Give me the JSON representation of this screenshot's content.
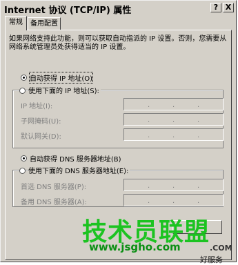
{
  "window": {
    "title": "Internet 协议 (TCP/IP) 属性",
    "help_btn": "?",
    "close_btn": "X"
  },
  "tabs": [
    "常规",
    "备用配置"
  ],
  "description": "如果网络支持此功能，则可以获取自动指派的 IP 设置。否则，您需要从网络系统管理员处获得适当的 IP 设置。",
  "ip_section": {
    "auto_label": "自动获得 IP 地址(O)",
    "manual_label": "使用下面的 IP 地址(S):",
    "auto_selected": true,
    "fields": [
      {
        "label": "IP 地址(I):",
        "value": ""
      },
      {
        "label": "子网掩码(U):",
        "value": ""
      },
      {
        "label": "默认网关(D):",
        "value": ""
      }
    ]
  },
  "dns_section": {
    "auto_label": "自动获得 DNS 服务器地址(B)",
    "manual_label": "使用下面的 DNS 服务器地址(E):",
    "auto_selected": true,
    "fields": [
      {
        "label": "首选 DNS 服务器(P):",
        "value": ""
      },
      {
        "label": "备用 DNS 服务器(A):",
        "value": ""
      }
    ]
  },
  "ok_button": "",
  "watermark": {
    "main": "技术员联盟",
    "url": "www.jsgho.com",
    "com": ".COM",
    "service": "好服务"
  }
}
